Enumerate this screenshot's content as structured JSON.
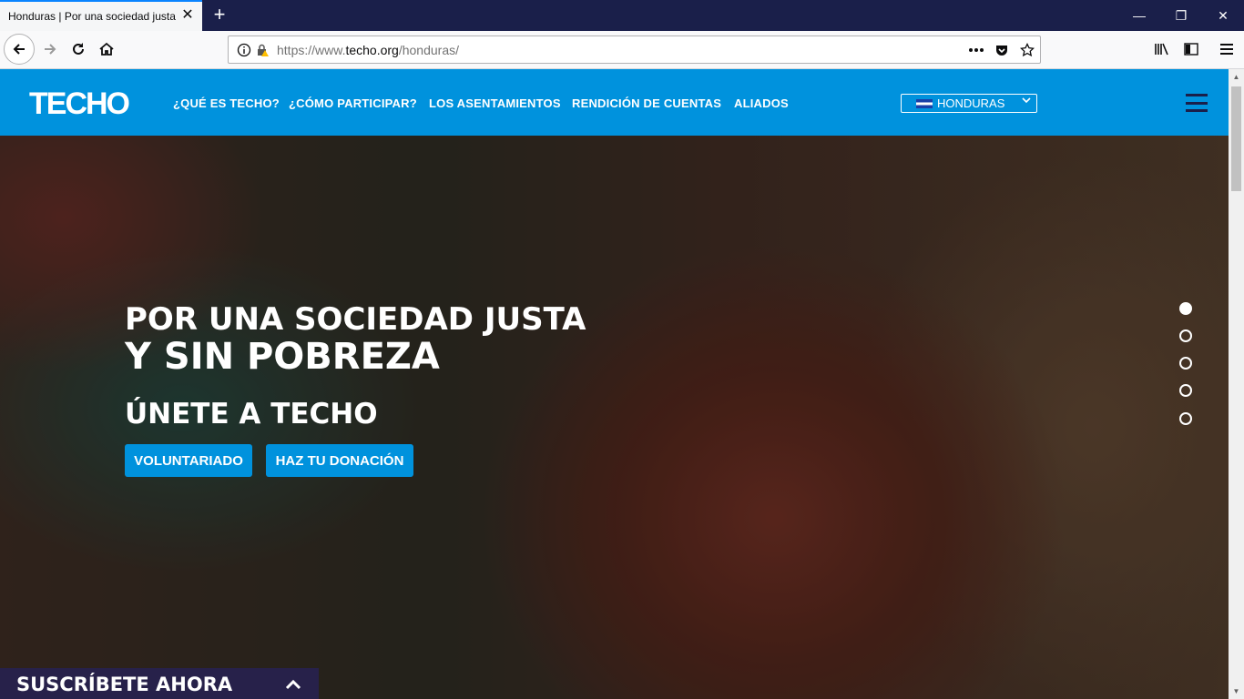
{
  "browser": {
    "tab_title": "Honduras | Por una sociedad justa y sin pobreza",
    "tab_close_glyph": "✕",
    "new_tab_glyph": "+",
    "window_controls": {
      "minimize": "—",
      "restore": "❐",
      "close": "✕"
    },
    "url_prefix": "https://www.",
    "url_domain": "techo.org",
    "url_path": "/honduras/",
    "toolbar_icons": [
      "back-icon",
      "forward-icon",
      "reload-icon",
      "home-icon",
      "info-icon",
      "lock-warning-icon",
      "more-icon",
      "pocket-icon",
      "bookmark-star-icon",
      "library-icon",
      "sidebar-icon",
      "menu-icon"
    ]
  },
  "site": {
    "logo": "TECHO",
    "nav": [
      "¿QUÉ ES TECHO?",
      "¿CÓMO PARTICIPAR?",
      "LOS ASENTAMIENTOS",
      "RENDICIÓN DE CUENTAS",
      "ALIADOS"
    ],
    "country": "HONDURAS",
    "brand_color": "#0092dd",
    "dark_color": "#1a1f4a"
  },
  "hero": {
    "title_line1": "POR UNA SOCIEDAD JUSTA",
    "title_line2": "Y SIN POBREZA",
    "subtitle": "ÚNETE A TECHO",
    "buttons": [
      "VOLUNTARIADO",
      "HAZ TU DONACIÓN"
    ],
    "slides_total": 5,
    "active_slide": 1
  },
  "subscribe": {
    "label": "SUSCRÍBETE AHORA"
  }
}
